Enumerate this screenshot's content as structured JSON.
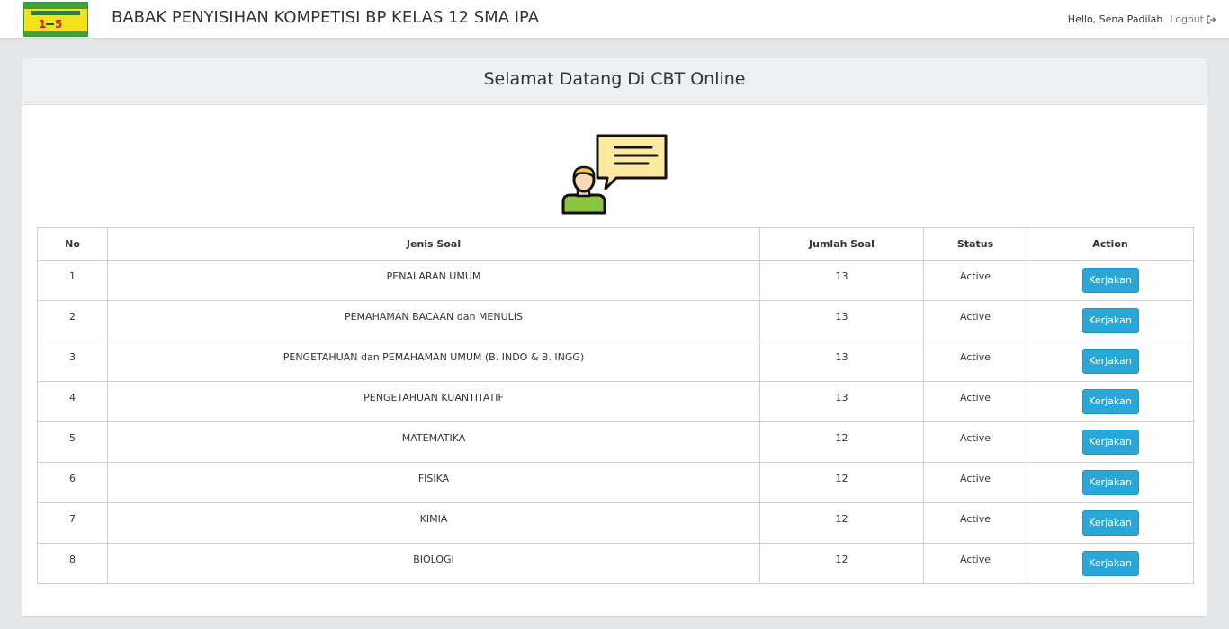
{
  "header": {
    "title": "BABAK PENYISIHAN KOMPETISI BP KELAS 12 SMA IPA",
    "greeting": "Hello, Sena Padilah",
    "logout_label": "Logout",
    "logo_digit_left": "1",
    "logo_digit_right": "5"
  },
  "panel": {
    "title": "Selamat Datang Di CBT Online"
  },
  "table": {
    "columns": [
      "No",
      "Jenis Soal",
      "Jumlah Soal",
      "Status",
      "Action"
    ],
    "rows": [
      {
        "no": "1",
        "jenis": "PENALARAN UMUM",
        "jumlah": "13",
        "status": "Active",
        "action": "Kerjakan"
      },
      {
        "no": "2",
        "jenis": "PEMAHAMAN BACAAN dan MENULIS",
        "jumlah": "13",
        "status": "Active",
        "action": "Kerjakan"
      },
      {
        "no": "3",
        "jenis": "PENGETAHUAN dan PEMAHAMAN UMUM (B. INDO & B. INGG)",
        "jumlah": "13",
        "status": "Active",
        "action": "Kerjakan"
      },
      {
        "no": "4",
        "jenis": "PENGETAHUAN KUANTITATIF",
        "jumlah": "13",
        "status": "Active",
        "action": "Kerjakan"
      },
      {
        "no": "5",
        "jenis": "MATEMATIKA",
        "jumlah": "12",
        "status": "Active",
        "action": "Kerjakan"
      },
      {
        "no": "6",
        "jenis": "FISIKA",
        "jumlah": "12",
        "status": "Active",
        "action": "Kerjakan"
      },
      {
        "no": "7",
        "jenis": "KIMIA",
        "jumlah": "12",
        "status": "Active",
        "action": "Kerjakan"
      },
      {
        "no": "8",
        "jenis": "BIOLOGI",
        "jumlah": "12",
        "status": "Active",
        "action": "Kerjakan"
      }
    ]
  },
  "icons": {
    "logo": "school-logo-icon",
    "logout": "sign-out-icon",
    "illustration": "person-speech-bubble-icon"
  },
  "colors": {
    "button": "#2aa7d9",
    "panel_header": "#eef1f3",
    "page_background": "#e4e5e7",
    "speech_bubble": "#fde9a0",
    "person_shirt": "#8bc53f",
    "person_hair": "#f7c948"
  }
}
